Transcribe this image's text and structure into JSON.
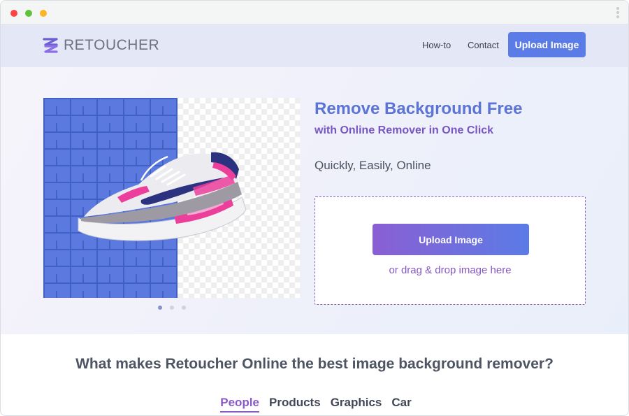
{
  "window": {
    "controls": [
      "close",
      "minimize",
      "maximize"
    ]
  },
  "navbar": {
    "logo_text": "RETOUCHER",
    "links": [
      {
        "label": "How-to"
      },
      {
        "label": "Contact"
      }
    ],
    "upload_label": "Upload Image"
  },
  "hero": {
    "title": "Remove Background Free",
    "subtitle": "with Online Remover in One Click",
    "tagline": "Quickly, Easily, Online",
    "upload_label": "Upload Image",
    "drop_hint": "or drag & drop image here",
    "carousel": {
      "count": 3,
      "active": 0
    }
  },
  "features": {
    "title": "What makes Retoucher Online the best image background remover?",
    "tabs": [
      {
        "label": "People",
        "active": true
      },
      {
        "label": "Products",
        "active": false
      },
      {
        "label": "Graphics",
        "active": false
      },
      {
        "label": "Car",
        "active": false
      }
    ]
  },
  "colors": {
    "accent_blue": "#5b7be6",
    "accent_purple": "#8a59c8",
    "title_blue": "#5b74d6"
  }
}
